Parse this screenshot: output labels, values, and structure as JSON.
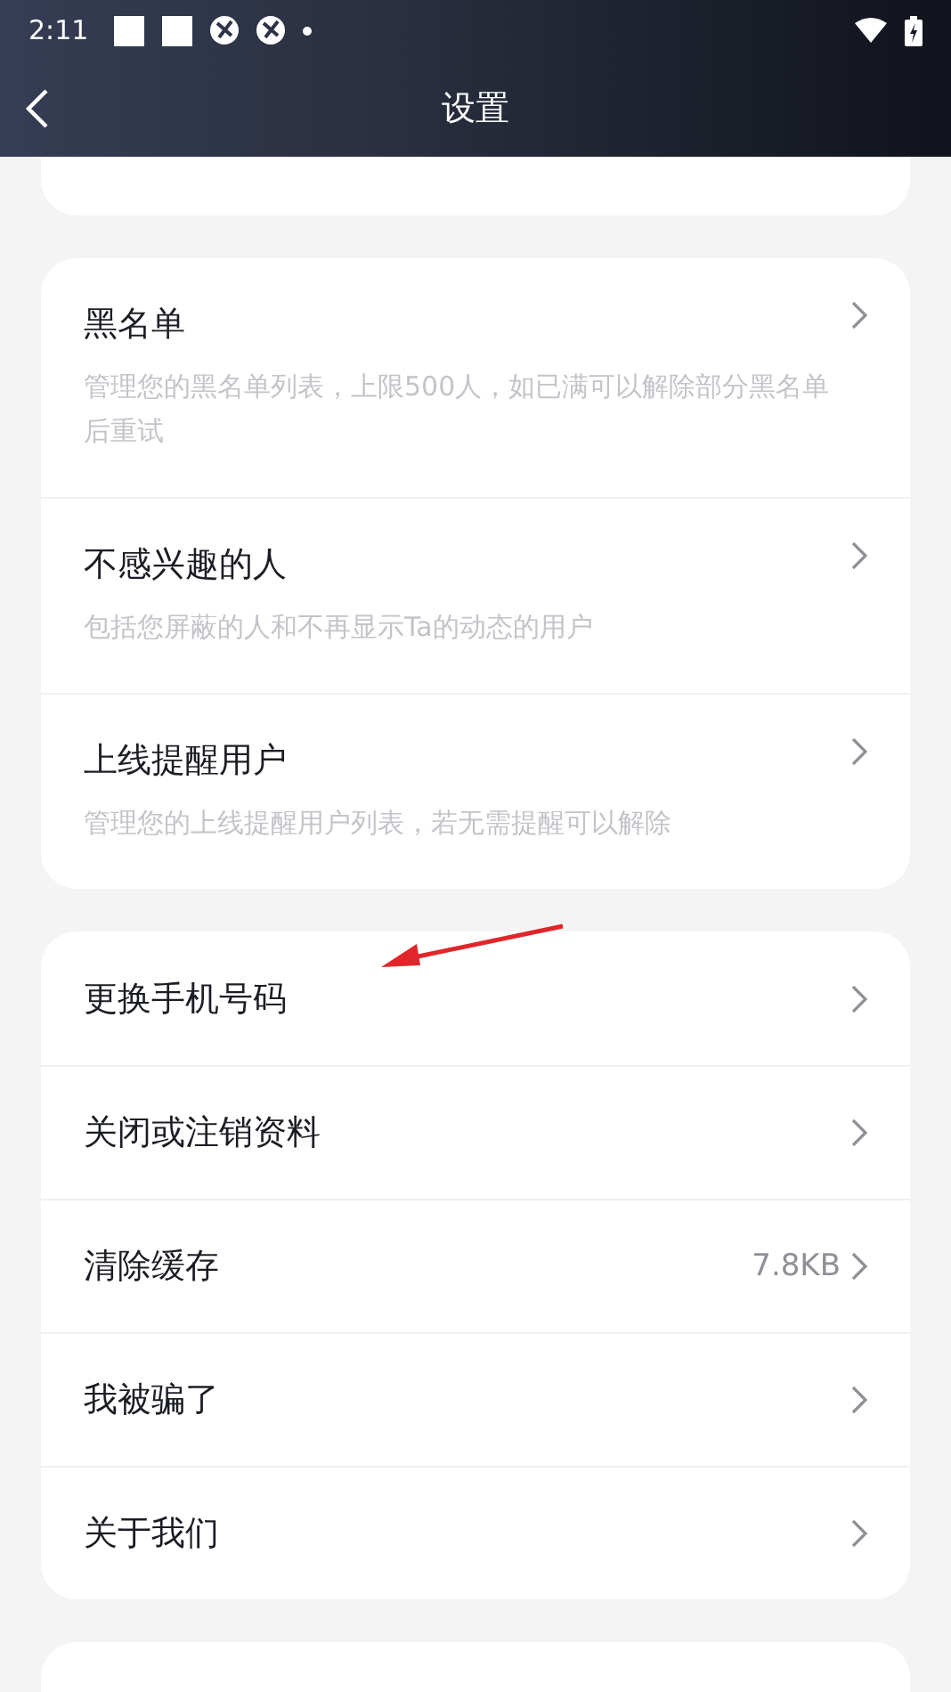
{
  "status_bar": {
    "time": "2:11"
  },
  "header": {
    "title": "设置"
  },
  "groups": [
    {
      "items": [
        {
          "title": "黑名单",
          "description": "管理您的黑名单列表，上限500人，如已满可以解除部分黑名单后重试"
        },
        {
          "title": "不感兴趣的人",
          "description": "包括您屏蔽的人和不再显示Ta的动态的用户"
        },
        {
          "title": "上线提醒用户",
          "description": "管理您的上线提醒用户列表，若无需提醒可以解除"
        }
      ]
    },
    {
      "items": [
        {
          "title": "更换手机号码"
        },
        {
          "title": "关闭或注销资料"
        },
        {
          "title": "清除缓存",
          "value": "7.8KB"
        },
        {
          "title": "我被骗了"
        },
        {
          "title": "关于我们"
        }
      ]
    }
  ]
}
